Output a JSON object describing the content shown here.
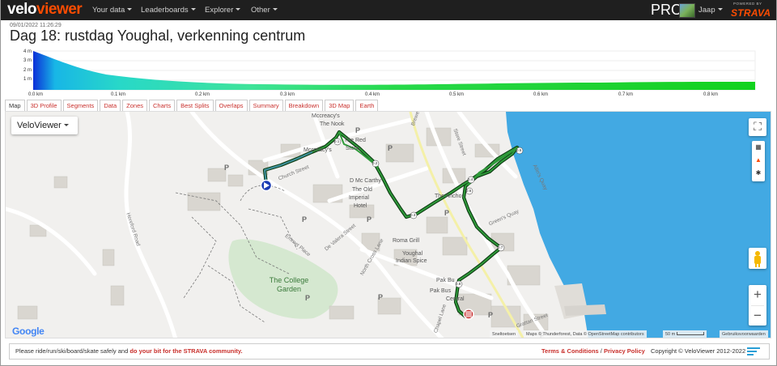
{
  "navbar": {
    "logo_a": "velo",
    "logo_b": "viewer",
    "menu": [
      "Your data",
      "Leaderboards",
      "Explorer",
      "Other"
    ],
    "pro": "PRO",
    "user": "Jaap",
    "powered_by": "POWERED BY",
    "strava": "STRAVA"
  },
  "activity": {
    "date": "09/01/2022 11:26:29",
    "title": "Dag 18: rustdag Youghal, verkenning centrum"
  },
  "elevation": {
    "y_ticks": [
      "4 m",
      "3 m",
      "2 m",
      "1 m"
    ],
    "x_ticks": [
      "0.0 km",
      "0.1 km",
      "0.2 km",
      "0.3 km",
      "0.4 km",
      "0.5 km",
      "0.6 km",
      "0.7 km",
      "0.8 km"
    ]
  },
  "tabs": [
    "Map",
    "3D Profile",
    "Segments",
    "Data",
    "Zones",
    "Charts",
    "Best Splits",
    "Overlaps",
    "Summary",
    "Breakdown",
    "3D Map",
    "Earth"
  ],
  "map": {
    "type_label": "VeloViewer",
    "park_label": "The College\nGarden",
    "labels": {
      "mccreadys": "Mccreacy's",
      "the_nook": "The Nook",
      "mccreadys2": "Mccreacy's",
      "the_red": "The Red",
      "store": "Store",
      "dmc": "D Mc Carthy",
      "the_old": "The Old",
      "imperial": "Imperial",
      "hotel": "Hotel",
      "the_anchor": "The Anchor",
      "roma": "Roma Grill",
      "youghal_indian": "Youghal",
      "indian_spice": "Indian Spice",
      "pak1": "Pak Bu",
      "pak2": "Pak Bus",
      "central": "Central",
      "church_st": "Church Street",
      "emmet": "Emmet Place",
      "devalera": "De Valera Street",
      "north_cross": "North Cross Lane",
      "store_st": "Store Street",
      "greens_quay": "Green's Quay",
      "allins_quay": "Allin's Quay",
      "brewery": "Brewery",
      "hereford": "Hereford Road",
      "chapel": "Chapel Lane",
      "grattan": "Grattan Street",
      "p": "P"
    },
    "km_markers": [
      "0.1",
      "0.2",
      "0.3",
      "0.4",
      "0.5",
      "0.6",
      "0.7",
      "0.8"
    ],
    "google": "Google",
    "shortcuts": "Sneltoetsen",
    "attribution": "Maps © Thunderforest, Data © OpenStreetMap contributors",
    "scale": "50 m",
    "terms": "Gebruiksvoorwaarden"
  },
  "footer": {
    "left_text": "Please ride/run/ski/board/skate safely and ",
    "left_link": "do your bit for the STRAVA community.",
    "terms": "Terms & Conditions",
    "privacy": "Privacy Policy",
    "copyright": "Copyright © VeloViewer 2012-2022"
  },
  "colors": {
    "navbar": "#1f1f1f",
    "brand_orange": "#fc4c02",
    "link_red": "#c9302c",
    "route": "#1a6b22",
    "water": "#42a9e3"
  }
}
